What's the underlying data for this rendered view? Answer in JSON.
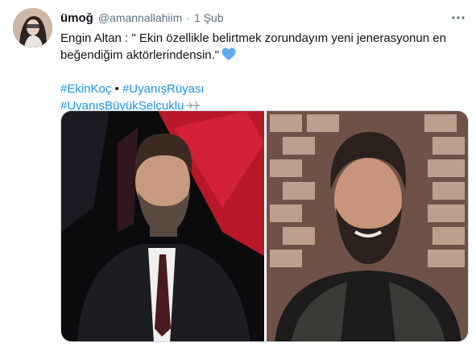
{
  "tweet": {
    "display_name": "ümoğ",
    "handle": "@amannallahiim",
    "separator": "·",
    "timestamp": "1 Şub",
    "text_line1": "Engin Altan : \" Ekin özellikle belirtmek zorundayım yeni jenerasyonun en",
    "text_line2": "beğendiğim aktörlerindensin.\"",
    "hashtag1": "#EkinKoç",
    "bullet": " • ",
    "hashtag2": "#UyanışRüyası",
    "hashtag3": "#UyanışBüyükSelçuklu",
    "emoji_heart": "blue-heart-icon",
    "emoji_plane": "airplane-icon",
    "more_icon": "more-options-icon"
  },
  "colors": {
    "link": "#1b95e0",
    "secondary_text": "#5b7083",
    "primary_text": "#0f1419",
    "heart": "#5dadec"
  },
  "media": {
    "count": 2,
    "photos": [
      {
        "subject": "man-in-suit-on-stage-red-background"
      },
      {
        "subject": "bearded-man-braided-hair-brick-wall"
      }
    ]
  }
}
